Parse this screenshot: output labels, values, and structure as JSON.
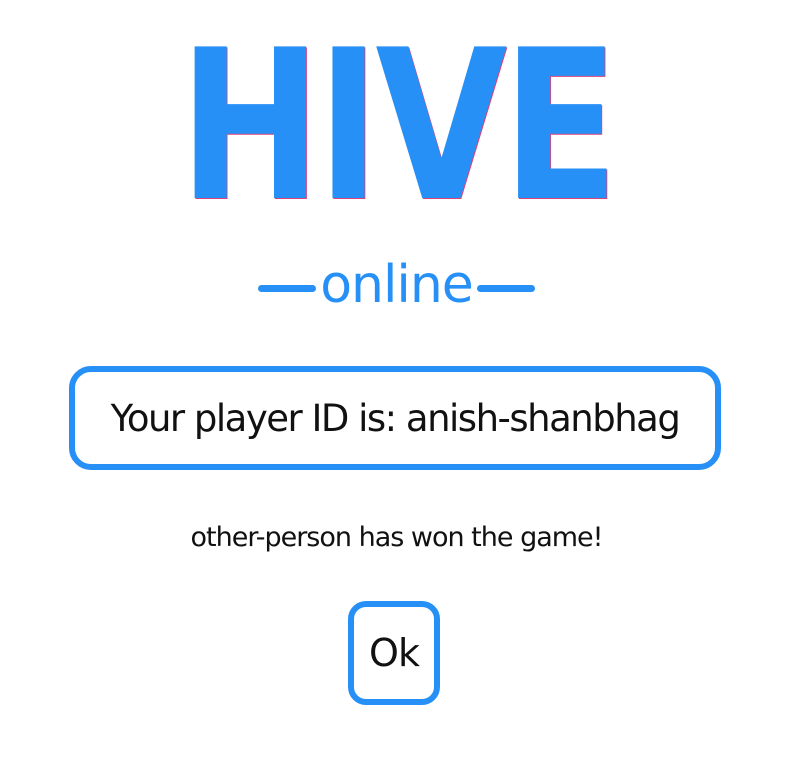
{
  "logo": {
    "title": "HIVE",
    "subtitle": "online"
  },
  "player": {
    "id_message": "Your player ID is: anish-shanbhag"
  },
  "result": {
    "message": "other-person has won the game!"
  },
  "actions": {
    "ok_label": "Ok"
  },
  "colors": {
    "accent": "#2790f7",
    "text": "#111111",
    "background": "#ffffff"
  }
}
